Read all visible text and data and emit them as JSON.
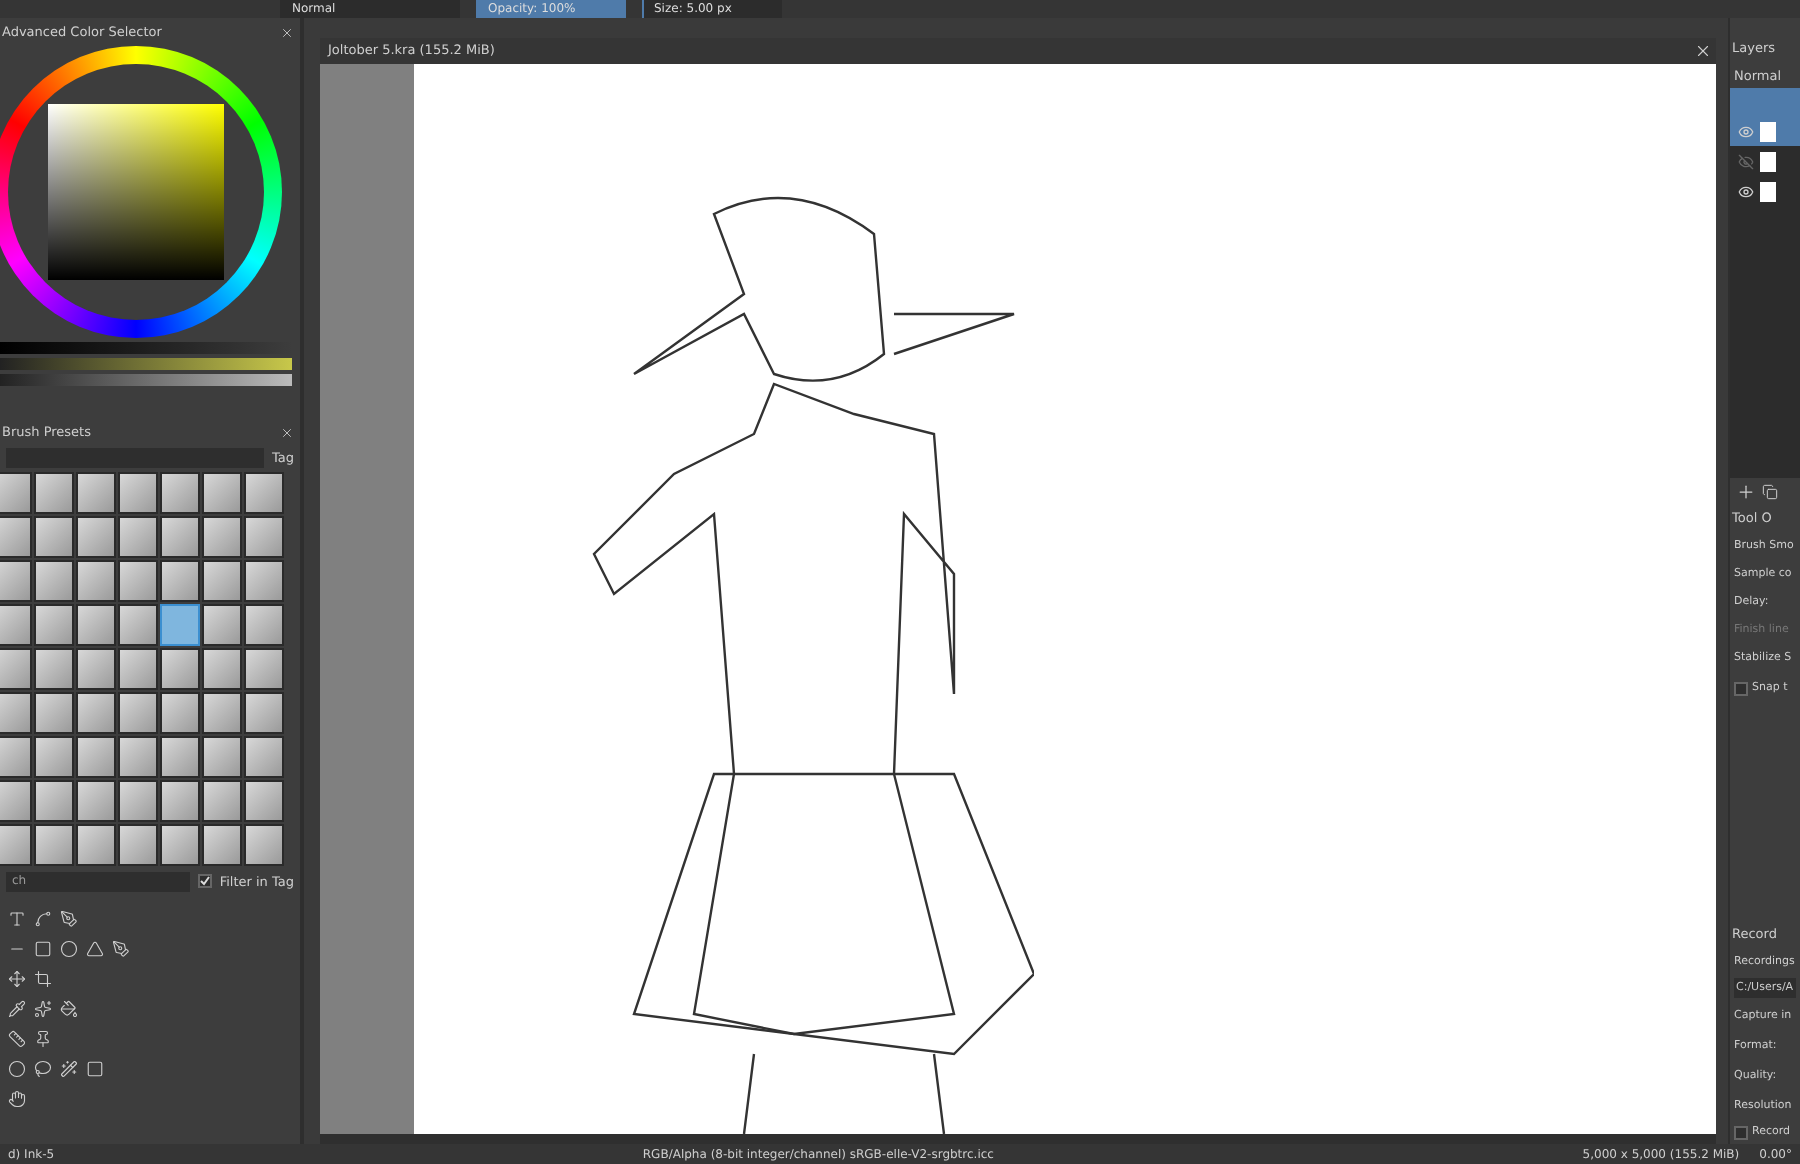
{
  "toolbar": {
    "blend_mode": "Normal",
    "opacity": {
      "text": "Opacity: 100%",
      "level": 1
    },
    "size": {
      "text": "Size: 5.00 px",
      "level": 0.02
    }
  },
  "color_selector": {
    "title": "Advanced Color Selector"
  },
  "brush_presets": {
    "title": "Brush Presets",
    "tag": "Tag",
    "search": "ch",
    "filter_in_tag": {
      "label": "Filter in Tag",
      "checked": true
    },
    "brushes": [
      {
        "selected": false
      },
      {
        "selected": false
      },
      {
        "selected": false
      },
      {
        "selected": false
      },
      {
        "selected": false
      },
      {
        "selected": false
      },
      {
        "selected": false
      },
      {
        "selected": false
      },
      {
        "selected": false
      },
      {
        "selected": false
      },
      {
        "selected": false
      },
      {
        "selected": false
      },
      {
        "selected": false
      },
      {
        "selected": false
      },
      {
        "selected": false
      },
      {
        "selected": false
      },
      {
        "selected": false
      },
      {
        "selected": false
      },
      {
        "selected": false
      },
      {
        "selected": false
      },
      {
        "selected": false
      },
      {
        "selected": false
      },
      {
        "selected": false
      },
      {
        "selected": false
      },
      {
        "selected": false
      },
      {
        "selected": true
      },
      {
        "selected": false
      },
      {
        "selected": false
      },
      {
        "selected": false
      },
      {
        "selected": false
      },
      {
        "selected": false
      },
      {
        "selected": false
      },
      {
        "selected": false
      },
      {
        "selected": false
      },
      {
        "selected": false
      },
      {
        "selected": false
      },
      {
        "selected": false
      },
      {
        "selected": false
      },
      {
        "selected": false
      },
      {
        "selected": false
      },
      {
        "selected": false
      },
      {
        "selected": false
      },
      {
        "selected": false
      },
      {
        "selected": false
      },
      {
        "selected": false
      },
      {
        "selected": false
      },
      {
        "selected": false
      },
      {
        "selected": false
      },
      {
        "selected": false
      },
      {
        "selected": false
      },
      {
        "selected": false
      },
      {
        "selected": false
      },
      {
        "selected": false
      },
      {
        "selected": false
      },
      {
        "selected": false
      },
      {
        "selected": false
      },
      {
        "selected": false
      },
      {
        "selected": false
      },
      {
        "selected": false
      },
      {
        "selected": false
      },
      {
        "selected": false
      },
      {
        "selected": false
      },
      {
        "selected": false
      }
    ]
  },
  "document": {
    "title": "Joltober 5.kra (155.2 MiB)"
  },
  "layers": {
    "title": "Layers",
    "blend_mode": "Normal",
    "rows": [
      {
        "visible": true,
        "selected": true
      },
      {
        "visible": false,
        "selected": false
      },
      {
        "visible": true,
        "selected": false
      }
    ]
  },
  "tool_options": {
    "title": "Tool O",
    "rows": [
      {
        "label": "Brush Smo",
        "disabled": false
      },
      {
        "label": "Sample co",
        "disabled": false
      },
      {
        "label": "Delay:",
        "disabled": false
      },
      {
        "label": "Finish line",
        "disabled": true
      },
      {
        "label": "Stabilize S",
        "disabled": false
      }
    ],
    "snap": {
      "label": "Snap t",
      "checked": false
    }
  },
  "recorder": {
    "title": "Record",
    "recordings_label": "Recordings",
    "path": "C:/Users/A",
    "rows": [
      "Capture in",
      "Format:",
      "Quality:",
      "Resolution"
    ],
    "record": {
      "label": "Record",
      "checked": false
    }
  },
  "status_bar": {
    "brush": "d) Ink-5",
    "color_space": "RGB/Alpha (8-bit integer/channel)  sRGB-elle-V2-srgbtrc.icc",
    "size": "5,000 x 5,000 (155.2 MiB)",
    "rotation": "0.00°"
  }
}
